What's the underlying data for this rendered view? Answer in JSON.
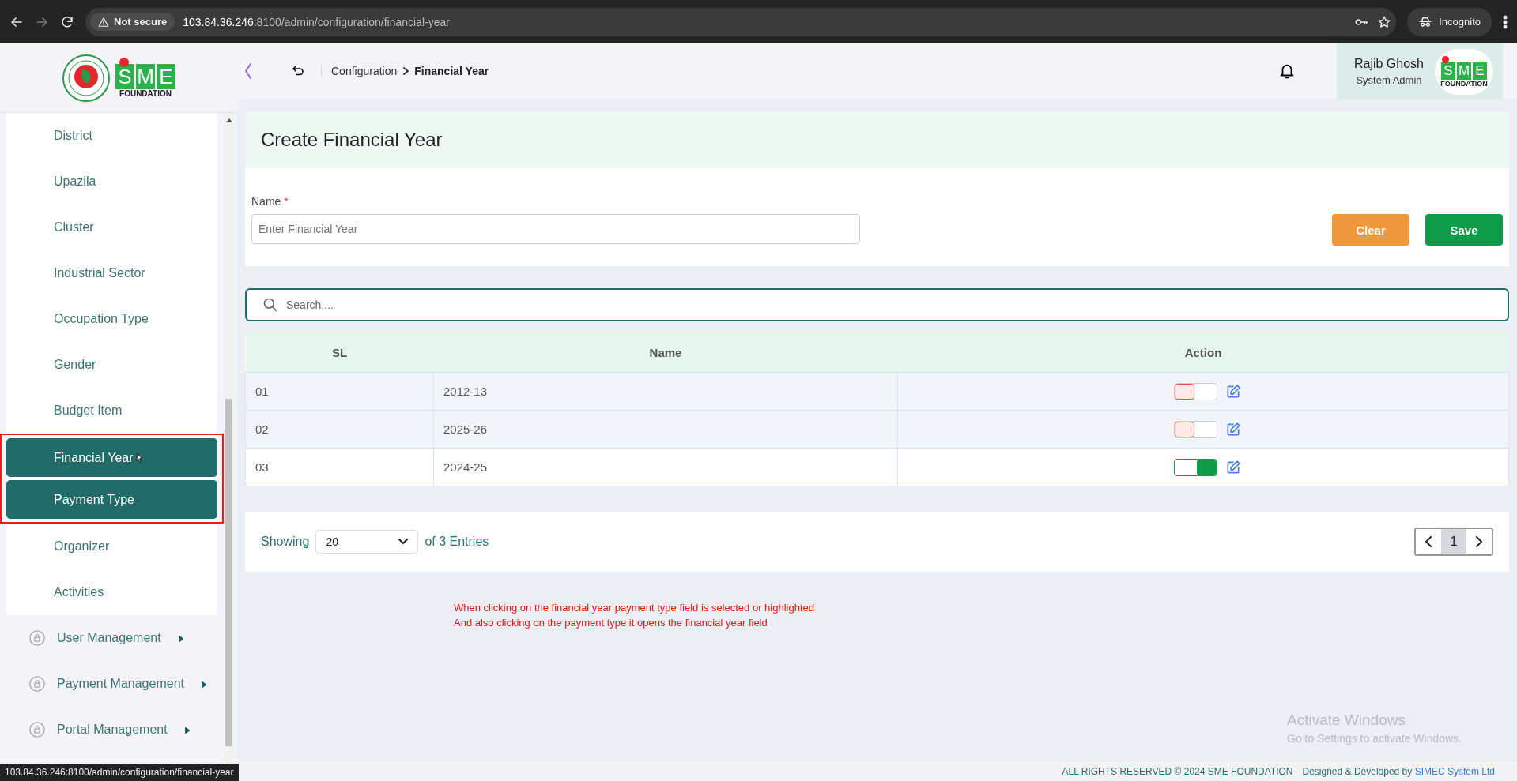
{
  "browser": {
    "security": "Not secure",
    "url_host": "103.84.36.246",
    "url_path": ":8100/admin/configuration/financial-year",
    "profile": "Incognito"
  },
  "logo": {
    "letters": [
      "S",
      "M",
      "E"
    ],
    "tagline": "FOUNDATION"
  },
  "breadcrumb": {
    "parent": "Configuration",
    "current": "Financial Year"
  },
  "user": {
    "name": "Rajib Ghosh",
    "role": "System Admin",
    "avatar_logo": {
      "letters": [
        "S",
        "M",
        "E"
      ],
      "tagline": "FOUNDATION"
    }
  },
  "sidebar": {
    "items": [
      {
        "label": "District",
        "selected": false,
        "annotated": false
      },
      {
        "label": "Upazila",
        "selected": false,
        "annotated": false
      },
      {
        "label": "Cluster",
        "selected": false,
        "annotated": false
      },
      {
        "label": "Industrial Sector",
        "selected": false,
        "annotated": false
      },
      {
        "label": "Occupation Type",
        "selected": false,
        "annotated": false
      },
      {
        "label": "Gender",
        "selected": false,
        "annotated": false
      },
      {
        "label": "Budget Item",
        "selected": false,
        "annotated": false
      },
      {
        "label": "Financial Year",
        "selected": true,
        "annotated": true
      },
      {
        "label": "Payment Type",
        "selected": true,
        "annotated": true
      },
      {
        "label": "Organizer",
        "selected": false,
        "annotated": false
      },
      {
        "label": "Activities",
        "selected": false,
        "annotated": false
      }
    ],
    "groups": [
      {
        "label": "User Management"
      },
      {
        "label": "Payment Management"
      },
      {
        "label": "Portal Management"
      }
    ]
  },
  "form": {
    "title": "Create Financial Year",
    "field_label": "Name",
    "required_mark": "*",
    "placeholder": "Enter Financial Year",
    "buttons": [
      {
        "label": "Clear",
        "kind": "clear"
      },
      {
        "label": "Save",
        "kind": "save"
      }
    ]
  },
  "search": {
    "placeholder": "Search...."
  },
  "table": {
    "columns": [
      "SL",
      "Name",
      "Action"
    ],
    "rows": [
      {
        "sl": "01",
        "name": "2012-13",
        "on": false
      },
      {
        "sl": "02",
        "name": "2025-26",
        "on": false
      },
      {
        "sl": "03",
        "name": "2024-25",
        "on": true
      }
    ]
  },
  "pagination": {
    "showing": "Showing",
    "page_size": "20",
    "entries": "of 3 Entries",
    "pages": [
      {
        "label": "1",
        "selected": true
      }
    ]
  },
  "annotation": {
    "lines": [
      "When clicking on the financial year payment type field is selected or highlighted",
      "And also clicking on the payment type it opens the financial year field"
    ]
  },
  "os_notice": {
    "title": "Activate Windows",
    "subtitle": "Go to Settings to activate Windows."
  },
  "footer": {
    "copyright": "ALL RIGHTS RESERVED © 2024 SME FOUNDATION",
    "credit": "Designed & Developed by",
    "credit_link": "SIMEC System Ltd"
  },
  "status_url": "103.84.36.246:8100/admin/configuration/financial-year"
}
